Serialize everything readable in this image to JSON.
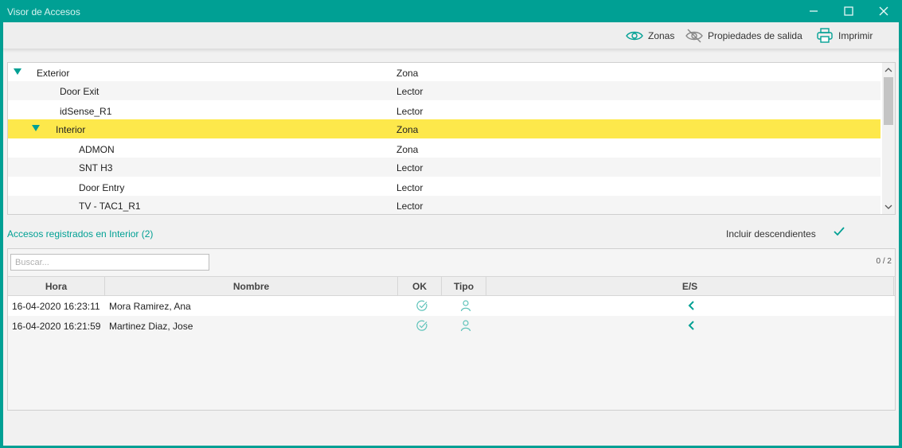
{
  "window": {
    "title": "Visor de Accesos",
    "accent": "#00a094"
  },
  "toolbar": {
    "zonas_label": "Zonas",
    "propiedades_label": "Propiedades de salida",
    "imprimir_label": "Imprimir"
  },
  "tree": {
    "rows": [
      {
        "name": "Exterior",
        "kind": "Zona",
        "level": 0,
        "expanded": true
      },
      {
        "name": "Door Exit",
        "kind": "Lector",
        "level": 1
      },
      {
        "name": "idSense_R1",
        "kind": "Lector",
        "level": 1
      },
      {
        "name": "Interior",
        "kind": "Zona",
        "level": 1,
        "expanded": true,
        "selected": true
      },
      {
        "name": "ADMON",
        "kind": "Zona",
        "level": 2
      },
      {
        "name": "SNT H3",
        "kind": "Lector",
        "level": 2
      },
      {
        "name": "Door Entry",
        "kind": "Lector",
        "level": 2
      },
      {
        "name": "TV - TAC1_R1",
        "kind": "Lector",
        "level": 2
      }
    ],
    "selected_color": "#fde84b"
  },
  "accesses": {
    "title": "Accesos registrados en Interior (2)",
    "include_label": "Incluir descendientes",
    "include_checked": true,
    "search_placeholder": "Buscar...",
    "count": "0 / 2",
    "columns": {
      "hora": "Hora",
      "nombre": "Nombre",
      "ok": "OK",
      "tipo": "Tipo",
      "es": "E/S"
    },
    "rows": [
      {
        "hora": "16-04-2020 16:23:11",
        "nombre": "Mora Ramirez, Ana",
        "ok_icon": "check-circle-icon",
        "tipo_icon": "person-icon",
        "es_icon": "chevron-left-icon"
      },
      {
        "hora": "16-04-2020 16:21:59",
        "nombre": "Martinez Diaz, Jose",
        "ok_icon": "check-circle-icon",
        "tipo_icon": "person-icon",
        "es_icon": "chevron-left-icon"
      }
    ]
  }
}
